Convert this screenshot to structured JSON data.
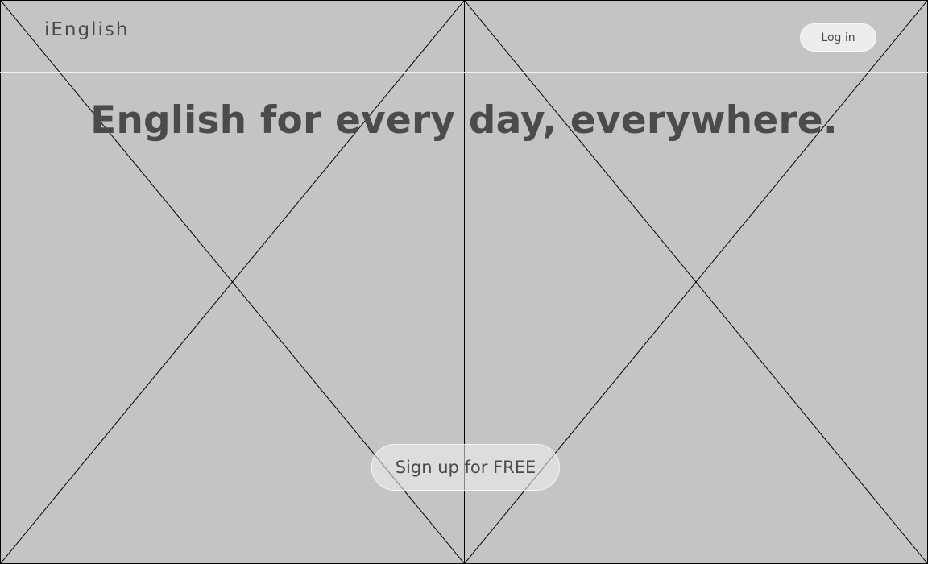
{
  "brand": {
    "name": "iEnglish"
  },
  "header": {
    "login_label": "Log in"
  },
  "hero": {
    "headline": "English for every day, everywhere."
  },
  "cta": {
    "label": "Sign up for FREE"
  },
  "placeholders": {
    "left": {
      "icon": "image-placeholder-icon"
    },
    "right": {
      "icon": "image-placeholder-icon"
    }
  }
}
